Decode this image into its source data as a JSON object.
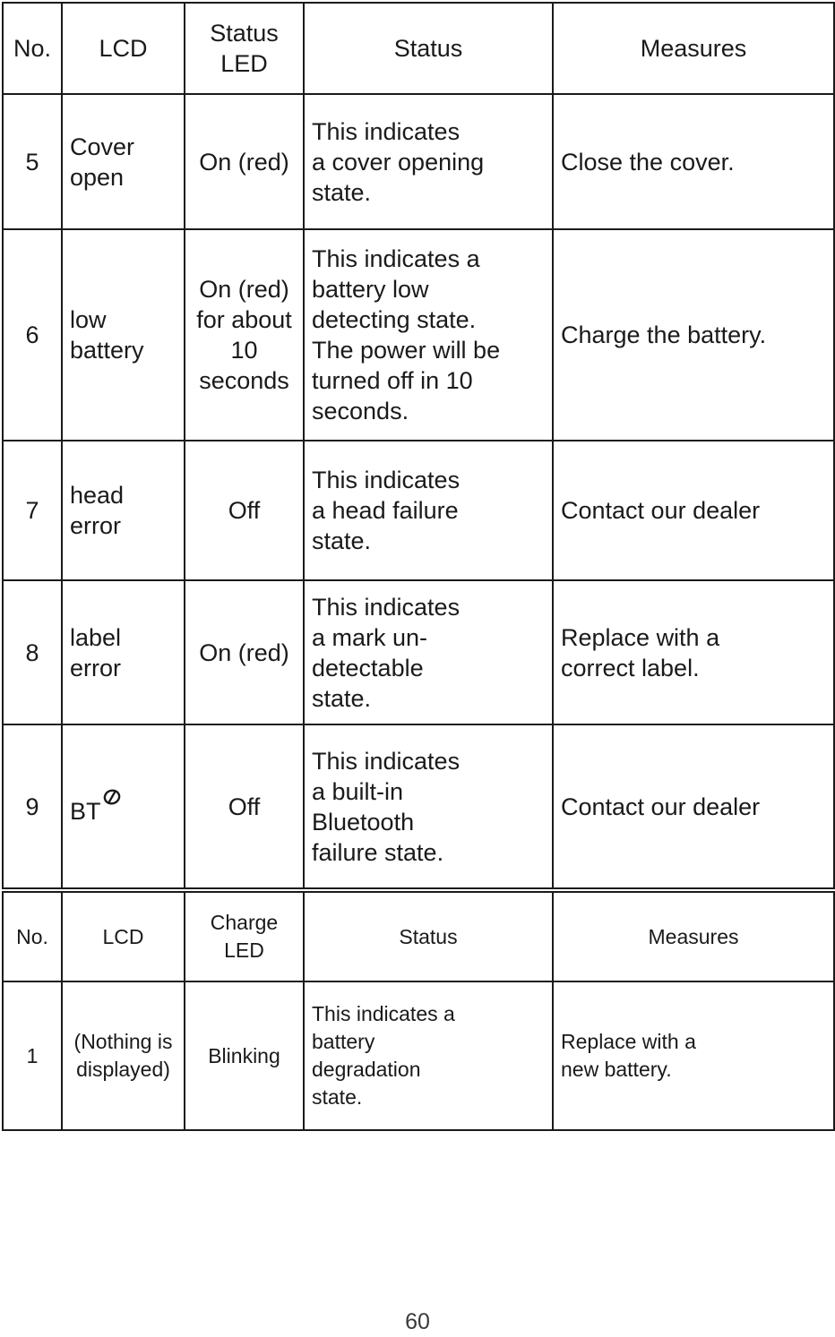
{
  "page": {
    "number": "60"
  },
  "tables": [
    {
      "id": "status-led",
      "headers": {
        "no": "No.",
        "lcd": "LCD",
        "led_line1": "Status",
        "led_line2": "LED",
        "status": "Status",
        "measures": "Measures"
      },
      "rows": [
        {
          "no": "5",
          "lcd_line1": "Cover",
          "lcd_line2": "open",
          "led": "On (red)",
          "status_line1": "This indicates",
          "status_line2": "a cover opening",
          "status_line3": "state.",
          "measures_line1": "Close the cover.",
          "measures_line2": ""
        },
        {
          "no": "6",
          "lcd_line1": "low",
          "lcd_line2": "battery",
          "led_line1": "On (red)",
          "led_line2": "for about",
          "led_line3": "10",
          "led_line4": "seconds",
          "status_line1": "This indicates a",
          "status_line2": "battery low",
          "status_line3": "detecting state.",
          "status_line4": "The power will be",
          "status_line5": "turned off in 10",
          "status_line6": "seconds.",
          "measures_line1": "Charge the battery.",
          "measures_line2": ""
        },
        {
          "no": "7",
          "lcd_line1": "head",
          "lcd_line2": "error",
          "led": "Off",
          "status_line1": "This indicates",
          "status_line2": "a head failure",
          "status_line3": "state.",
          "measures_line1": "Contact our dealer",
          "measures_line2": ""
        },
        {
          "no": "8",
          "lcd_line1": "label",
          "lcd_line2": "error",
          "led": "On (red)",
          "status_line1": "This indicates",
          "status_line2": "a mark un-",
          "status_line3": "detectable",
          "status_line4": "state.",
          "measures_line1": "Replace with a",
          "measures_line2": "correct label."
        },
        {
          "no": "9",
          "lcd_text": "BT",
          "lcd_icon": "prohibited-icon",
          "led": "Off",
          "status_line1": "This indicates",
          "status_line2": "a built-in",
          "status_line3": "Bluetooth",
          "status_line4": "failure state.",
          "measures_line1": "Contact our dealer",
          "measures_line2": ""
        }
      ]
    },
    {
      "id": "charge-led",
      "headers": {
        "no": "No.",
        "lcd": "LCD",
        "led_line1": "Charge",
        "led_line2": "LED",
        "status": "Status",
        "measures": "Measures"
      },
      "rows": [
        {
          "no": "1",
          "lcd_line1": "(Nothing is",
          "lcd_line2": "displayed)",
          "led": "Blinking",
          "status_line1": "This indicates a",
          "status_line2": "battery",
          "status_line3": "degradation",
          "status_line4": "state.",
          "measures_line1": "Replace with a",
          "measures_line2": "new battery."
        }
      ]
    }
  ],
  "colors": {
    "text": "#1a1a1a",
    "border": "#1a1a1a",
    "background": "#ffffff"
  }
}
